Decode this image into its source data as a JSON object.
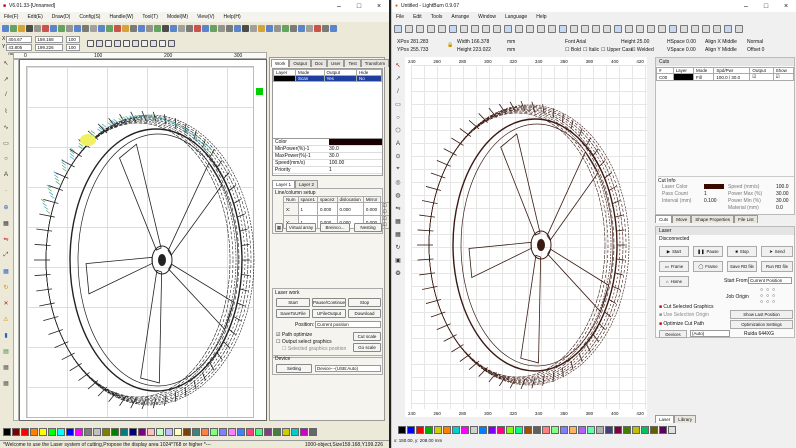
{
  "left": {
    "title": "V6.01.33-[Unnamed]",
    "menu": [
      "File(F)",
      "Edit(E)",
      "Draw(D)",
      "Config(S)",
      "Handle(W)",
      "Tool(T)",
      "Model(M)",
      "View(V)",
      "Help(H)"
    ],
    "coords": {
      "x": "404.67 mm",
      "y": "43.805 mm",
      "w": "159.168 mm",
      "h": "199.226 mm",
      "s1": "100",
      "s2": "100"
    },
    "tabs": [
      "Work",
      "Output",
      "Doc",
      "User",
      "Test",
      "Transform"
    ],
    "layer_table": {
      "headers": [
        "Layer",
        "Mode",
        "Output",
        "Hide"
      ],
      "row": [
        "",
        "Scan",
        "Yes",
        "No"
      ]
    },
    "props": [
      [
        "Color",
        ""
      ],
      [
        "MinPower(%)-1",
        "30.0"
      ],
      [
        "MaxPower(%)-1",
        "30.0"
      ],
      [
        "Speed(mm/s)",
        "100.00"
      ],
      [
        "Priority",
        "1"
      ]
    ],
    "layer_tabs": [
      "Layer 1",
      "Layer 2"
    ],
    "line_col": {
      "title": "Line/column setup",
      "headers": [
        "Num",
        "space1",
        "space2",
        "dislocation",
        "Mirror"
      ],
      "rows": [
        [
          "X:",
          "1",
          "0.000",
          "0.000",
          "0.000"
        ],
        [
          "Y:",
          "1",
          "0.000",
          "0.000",
          "0.000"
        ]
      ],
      "buttons": [
        "Virtual array",
        "Breinco...",
        "Nesting"
      ]
    },
    "laser_work": {
      "title": "Laser work",
      "buttons": [
        "Start",
        "Pause/Continue",
        "Stop",
        "SaveToUFile",
        "UFileOutput",
        "Download"
      ],
      "position_label": "Position:",
      "position_value": "Current position",
      "path_opt": "Path optimize",
      "output_sel": "Output select graphics",
      "sel_sub": "Selected graphics position",
      "cut_scale": "Cut scale",
      "go_scale": "Go scale"
    },
    "device": {
      "title": "Device",
      "setting": "Setting",
      "value": "Device---(USB:Auto)"
    },
    "status_msg": "*Welcome to use the Laser system of cutting,Propose the display area 1024*768 or higher *---",
    "status_info": "1000-object,Size159.168,Y199.226",
    "ruler_marks": [
      "0",
      "100",
      "200",
      "300"
    ],
    "colors": [
      "#000000",
      "#7b0000",
      "#ff0000",
      "#ff7f00",
      "#ffff00",
      "#00ff00",
      "#00ffff",
      "#0000ff",
      "#ff00ff",
      "#7f7f7f",
      "#c0c0c0",
      "#7f7f00",
      "#007f00",
      "#007f7f",
      "#00007f",
      "#7f007f",
      "#ffbfbf",
      "#bfffbf",
      "#bfbfff",
      "#ffffbf",
      "#804000",
      "#408080",
      "#ff8040",
      "#80ff80",
      "#8080ff",
      "#ff80ff",
      "#4080ff",
      "#ff4080",
      "#40ff80",
      "#804080",
      "#408040",
      "#cccc00",
      "#00cccc",
      "#cc00cc",
      "#666666"
    ]
  },
  "right": {
    "title": "Untitled - LightBurn 0.9.07",
    "menu": [
      "File",
      "Edit",
      "Tools",
      "Arrange",
      "Window",
      "Language",
      "Help"
    ],
    "pos": {
      "xpos": "XPos 281.283",
      "ypos": "YPos 255.733",
      "w": "Width 166.378",
      "h": "Height 223.022",
      "u": "mm"
    },
    "font": {
      "font": "Font Arial",
      "height": "Height 25.00",
      "hspace": "HSpace 0.00",
      "vspace": "VSpace 0.00",
      "bold": "Bold",
      "italic": "Italic",
      "upper": "Upper Case",
      "welded": "Welded",
      "alignx": "Align X Middle",
      "aligny": "Align Y Middle",
      "normal": "Normal",
      "offset": "Offset 0"
    },
    "ruler_top": [
      "240",
      "260",
      "280",
      "300",
      "320",
      "340",
      "360",
      "380",
      "400",
      "420"
    ],
    "ruler_bottom": [
      "240",
      "260",
      "280",
      "300",
      "320",
      "340",
      "360",
      "380",
      "400",
      "420"
    ],
    "cuts": {
      "title": "Cuts",
      "headers": [
        "#",
        "Layer",
        "Mode",
        "Spd/Pwr",
        "Output",
        "Show"
      ],
      "row": [
        "C00",
        "",
        "Fill",
        "100.0 / 30.0",
        "",
        ""
      ]
    },
    "cut_info": {
      "title": "Cut Info",
      "fields": [
        [
          "Laser Color",
          ""
        ],
        [
          "Pass Count",
          "1"
        ],
        [
          "Interval (mm)",
          "0.100"
        ],
        [
          "Speed (mm/s)",
          "100.0"
        ],
        [
          "Power Max (%)",
          "30.00"
        ],
        [
          "Power Min (%)",
          "30.00"
        ],
        [
          "Material (mm)",
          "0.0"
        ]
      ]
    },
    "tabs1": [
      "Cuts",
      "Move",
      "Shape Properties",
      "File List"
    ],
    "laser": {
      "title": "Laser",
      "state": "Disconnected",
      "buttons": [
        "Start",
        "Pause",
        "Stop",
        "Send",
        "Frame",
        "Frame",
        "Save RD file",
        "Run RD file",
        "Home"
      ],
      "start_from": "Start From:",
      "start_val": "Current Position",
      "job_origin": "Job Origin",
      "checks": [
        "Cut Selected Graphics",
        "Use Selection Origin",
        "Optimize Cut Path"
      ],
      "show_last": "Show Last Position",
      "opt_settings": "Optimization Settings",
      "devices": "Devices",
      "auto": "(Auto)",
      "ruida": "Ruida 644XG"
    },
    "tabs2": [
      "Laser",
      "Library"
    ],
    "status": "x: 150.00, y: 208.00 mm",
    "colors": [
      "#000000",
      "#0000ff",
      "#ff0000",
      "#00b000",
      "#d0d000",
      "#ff8000",
      "#00d0d0",
      "#ff00ff",
      "#d0d0d0",
      "#0080ff",
      "#8000ff",
      "#ff0080",
      "#80ff00",
      "#00ff80",
      "#a05000",
      "#606060",
      "#ff8080",
      "#80ff80",
      "#8080ff",
      "#ffb060",
      "#b060ff",
      "#60ffb0",
      "#b0b0b0",
      "#404080",
      "#800040",
      "#408000",
      "#c0c000",
      "#00c060",
      "#606000",
      "#600060",
      "#e0e0e0"
    ]
  }
}
